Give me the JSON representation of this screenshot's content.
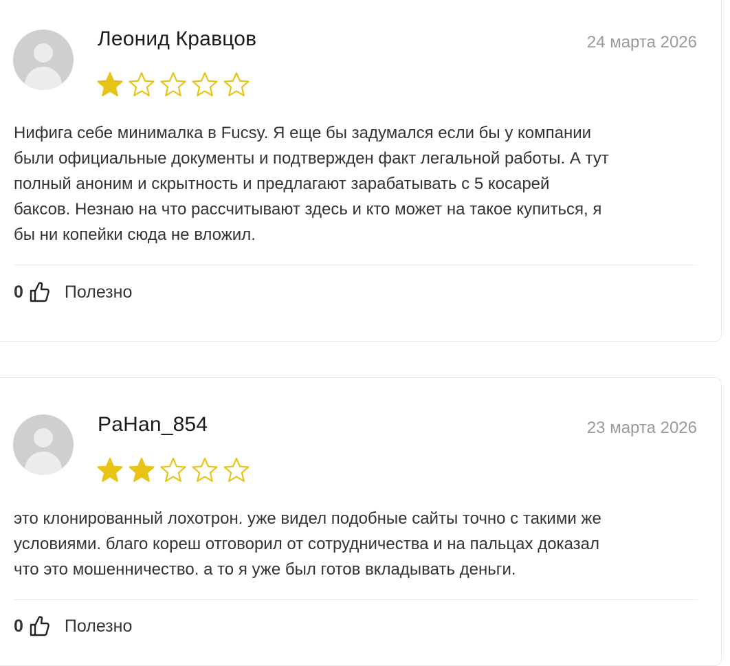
{
  "reviews": [
    {
      "author": "Леонид Кравцов",
      "date": "24 марта 2026",
      "rating": 1,
      "max_rating": 5,
      "text": "Нифига себе минималка в Fucsy. Я еще бы задумался если бы у компании\nбыли официальные документы и подтвержден факт легальной работы. А тут\nполный аноним и скрытность и предлагают зарабатывать с 5 косарей\nбаксов. Незнаю на что рассчитывают здесь и кто может на такое купиться, я\nбы ни копейки сюда не вложил.",
      "helpful_count": "0",
      "helpful_label": "Полезно"
    },
    {
      "author": "PaHan_854",
      "date": "23 марта 2026",
      "rating": 2,
      "max_rating": 5,
      "text": "это клонированный лохотрон. уже видел подобные сайты точно с такими же\nусловиями. благо кореш отговорил от сотрудничества и на пальцах доказал\nчто это мошенничество. а то я уже был готов вкладывать деньги.",
      "helpful_count": "0",
      "helpful_label": "Полезно"
    }
  ],
  "colors": {
    "star": "#e8c318",
    "avatar": "#cfcfcf",
    "date": "#9a9a9a"
  },
  "icons": {
    "avatar": "user-avatar-icon",
    "star_filled": "star-filled-icon",
    "star_empty": "star-outline-icon",
    "helpful": "thumbs-up-icon"
  }
}
